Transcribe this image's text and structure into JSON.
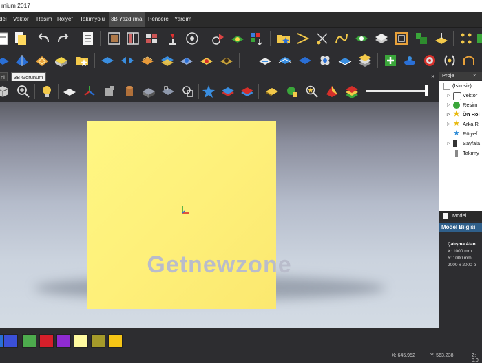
{
  "window": {
    "title": "mium 2017"
  },
  "menu": {
    "items": [
      "del",
      "Vektör",
      "Resim",
      "Rölyef",
      "Takımyolu",
      "3B Yazdırma",
      "Pencere",
      "Yardım"
    ],
    "active_index": 5
  },
  "tabs": [
    "ni",
    "3B Görünüm"
  ],
  "tab_close": "×",
  "viewport": {
    "watermark": "Getnewzone"
  },
  "project_panel": {
    "title": "Proje",
    "close": "×",
    "tree": [
      "(İsimsiz)",
      "Vektör",
      "Resim",
      "Ön Röl",
      "Arka R",
      "Rölyef",
      "Sayfala",
      "Takımy"
    ]
  },
  "model_panel": {
    "tab": "Model",
    "header": "Model Bilgisi",
    "section": "Çalışma Alanı",
    "x": "X: 1000 mm",
    "y": "Y: 1000 mm",
    "res": "2000 x 2000 p"
  },
  "palette_colors": [
    "#2a6fd6",
    "#3b50d8",
    "#4dab4d",
    "#d51f2a",
    "#8e2bd1",
    "#fffaa0",
    "#a59a2a",
    "#f5c516"
  ],
  "status": {
    "x": "X: 645.952",
    "y": "Y: 563.238",
    "z": "Z: 0,0"
  }
}
